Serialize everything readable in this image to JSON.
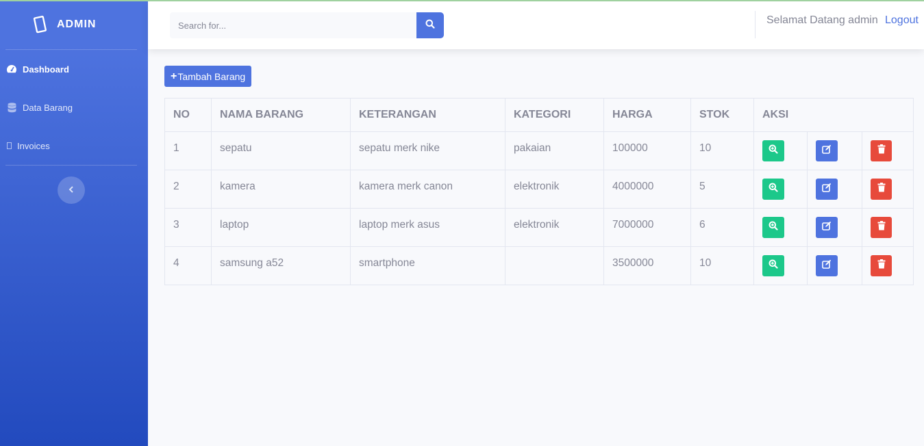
{
  "sidebar": {
    "brand": "ADMIN",
    "items": [
      {
        "label": "Dashboard",
        "icon": "tachometer-icon"
      },
      {
        "label": "Data Barang",
        "icon": "database-icon"
      },
      {
        "label": "Invoices",
        "icon": "file-icon"
      }
    ]
  },
  "topbar": {
    "search_placeholder": "Search for...",
    "welcome": "Selamat Datang admin",
    "logout": "Logout"
  },
  "content": {
    "add_button": "Tambah Barang"
  },
  "table": {
    "headers": [
      "NO",
      "NAMA BARANG",
      "KETERANGAN",
      "KATEGORI",
      "HARGA",
      "STOK",
      "AKSI"
    ],
    "rows": [
      {
        "no": "1",
        "nama": "sepatu",
        "keterangan": "sepatu merk nike",
        "kategori": "pakaian",
        "harga": "100000",
        "stok": "10"
      },
      {
        "no": "2",
        "nama": "kamera",
        "keterangan": "kamera merk canon",
        "kategori": "elektronik",
        "harga": "4000000",
        "stok": "5"
      },
      {
        "no": "3",
        "nama": "laptop",
        "keterangan": "laptop merk asus",
        "kategori": "elektronik",
        "harga": "7000000",
        "stok": "6"
      },
      {
        "no": "4",
        "nama": "samsung a52",
        "keterangan": "smartphone",
        "kategori": "",
        "harga": "3500000",
        "stok": "10"
      }
    ]
  },
  "colors": {
    "primary": "#4e73df",
    "success": "#1cc88a",
    "danger": "#e74a3b",
    "text": "#858796"
  }
}
